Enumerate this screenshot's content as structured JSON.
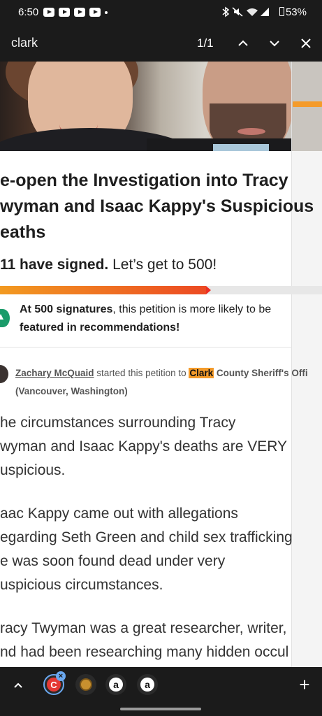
{
  "status_bar": {
    "time": "6:50",
    "battery": "53%",
    "icons": [
      "youtube-icon",
      "youtube-icon",
      "youtube-icon",
      "youtube-icon",
      "bluetooth-icon",
      "mute-icon",
      "wifi-icon",
      "signal-icon",
      "battery-icon"
    ]
  },
  "find_bar": {
    "query": "clark",
    "match_count": "1/1"
  },
  "petition": {
    "title_lines": [
      "e-open the Investigation into Tracy",
      "wyman and Isaac Kappy's Suspicious",
      "eaths"
    ],
    "signed_count": "11 have signed.",
    "signed_goal": "Let’s get to 500!",
    "progress": 0.64,
    "milestone_bold": "At 500 signatures",
    "milestone_rest": ", this petition is more likely to be",
    "milestone_line2": "featured in recommendations!",
    "starter_name": "Zachary McQuaid",
    "starter_mid": " started this petition to ",
    "starter_match": "Clark",
    "starter_target": " County Sheriff's Offi",
    "starter_location": "(Vancouver, Washington)",
    "body_paragraphs": [
      [
        "he circumstances surrounding Tracy",
        "wyman and Isaac Kappy's deaths are VERY",
        "uspicious."
      ],
      [
        "aac Kappy came out with allegations",
        "egarding Seth Green and child sex trafficking",
        "e was soon found dead under very",
        "uspicious circumstances."
      ],
      [
        "racy Twyman was a great researcher, writer,",
        "nd had been researching many hidden occul"
      ]
    ]
  },
  "bottom_bar": {
    "tabs": [
      {
        "label": "C",
        "color": "#e53935"
      },
      {
        "label": "",
        "color": "#c8902f"
      },
      {
        "label": "a",
        "color": "#ffffff"
      },
      {
        "label": "a",
        "color": "#ffffff"
      }
    ],
    "close_badge": "×",
    "add_label": "+"
  }
}
